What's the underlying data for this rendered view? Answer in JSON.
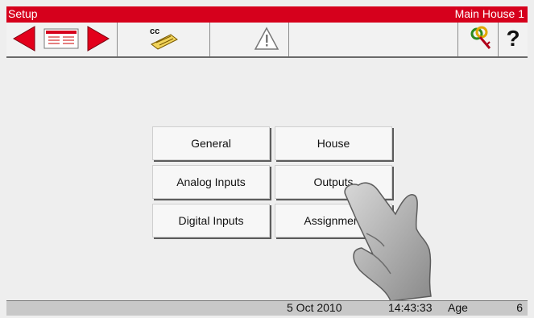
{
  "titlebar": {
    "left": "Setup",
    "right": "Main House 1"
  },
  "toolbar": {
    "icons": [
      "prev-arrow-icon",
      "card-icon",
      "next-arrow-icon",
      "cc-notepad-icon",
      "warning-icon",
      "key-icon",
      "help-icon"
    ],
    "cc_label": "cc",
    "help_label": "?"
  },
  "menu": {
    "general": "General",
    "house": "House",
    "analog_inputs": "Analog Inputs",
    "outputs": "Outputs",
    "digital_inputs": "Digital Inputs",
    "assignment": "Assignment"
  },
  "status": {
    "date": "5 Oct 2010",
    "time": "14:43:33",
    "age_label": "Age",
    "age_value": "6"
  },
  "colors": {
    "title_red": "#d6001c",
    "arrow_red": "#e3001b",
    "button_bg": "#f7f7f7",
    "screen_bg": "#eeeeee"
  }
}
